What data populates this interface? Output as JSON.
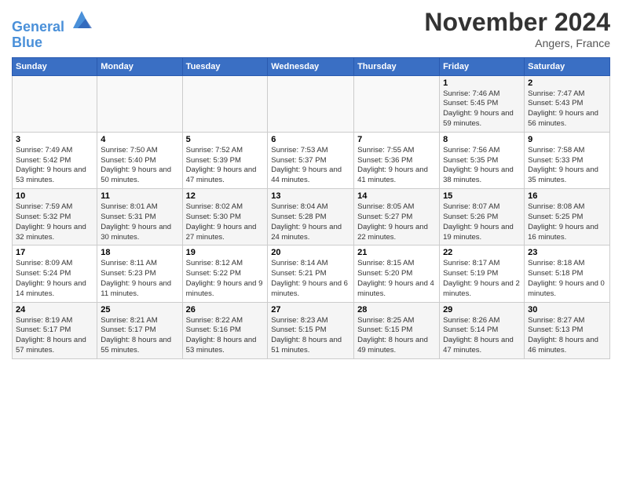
{
  "header": {
    "logo_line1": "General",
    "logo_line2": "Blue",
    "month": "November 2024",
    "location": "Angers, France"
  },
  "days_of_week": [
    "Sunday",
    "Monday",
    "Tuesday",
    "Wednesday",
    "Thursday",
    "Friday",
    "Saturday"
  ],
  "weeks": [
    [
      {
        "day": "",
        "info": ""
      },
      {
        "day": "",
        "info": ""
      },
      {
        "day": "",
        "info": ""
      },
      {
        "day": "",
        "info": ""
      },
      {
        "day": "",
        "info": ""
      },
      {
        "day": "1",
        "info": "Sunrise: 7:46 AM\nSunset: 5:45 PM\nDaylight: 9 hours and 59 minutes."
      },
      {
        "day": "2",
        "info": "Sunrise: 7:47 AM\nSunset: 5:43 PM\nDaylight: 9 hours and 56 minutes."
      }
    ],
    [
      {
        "day": "3",
        "info": "Sunrise: 7:49 AM\nSunset: 5:42 PM\nDaylight: 9 hours and 53 minutes."
      },
      {
        "day": "4",
        "info": "Sunrise: 7:50 AM\nSunset: 5:40 PM\nDaylight: 9 hours and 50 minutes."
      },
      {
        "day": "5",
        "info": "Sunrise: 7:52 AM\nSunset: 5:39 PM\nDaylight: 9 hours and 47 minutes."
      },
      {
        "day": "6",
        "info": "Sunrise: 7:53 AM\nSunset: 5:37 PM\nDaylight: 9 hours and 44 minutes."
      },
      {
        "day": "7",
        "info": "Sunrise: 7:55 AM\nSunset: 5:36 PM\nDaylight: 9 hours and 41 minutes."
      },
      {
        "day": "8",
        "info": "Sunrise: 7:56 AM\nSunset: 5:35 PM\nDaylight: 9 hours and 38 minutes."
      },
      {
        "day": "9",
        "info": "Sunrise: 7:58 AM\nSunset: 5:33 PM\nDaylight: 9 hours and 35 minutes."
      }
    ],
    [
      {
        "day": "10",
        "info": "Sunrise: 7:59 AM\nSunset: 5:32 PM\nDaylight: 9 hours and 32 minutes."
      },
      {
        "day": "11",
        "info": "Sunrise: 8:01 AM\nSunset: 5:31 PM\nDaylight: 9 hours and 30 minutes."
      },
      {
        "day": "12",
        "info": "Sunrise: 8:02 AM\nSunset: 5:30 PM\nDaylight: 9 hours and 27 minutes."
      },
      {
        "day": "13",
        "info": "Sunrise: 8:04 AM\nSunset: 5:28 PM\nDaylight: 9 hours and 24 minutes."
      },
      {
        "day": "14",
        "info": "Sunrise: 8:05 AM\nSunset: 5:27 PM\nDaylight: 9 hours and 22 minutes."
      },
      {
        "day": "15",
        "info": "Sunrise: 8:07 AM\nSunset: 5:26 PM\nDaylight: 9 hours and 19 minutes."
      },
      {
        "day": "16",
        "info": "Sunrise: 8:08 AM\nSunset: 5:25 PM\nDaylight: 9 hours and 16 minutes."
      }
    ],
    [
      {
        "day": "17",
        "info": "Sunrise: 8:09 AM\nSunset: 5:24 PM\nDaylight: 9 hours and 14 minutes."
      },
      {
        "day": "18",
        "info": "Sunrise: 8:11 AM\nSunset: 5:23 PM\nDaylight: 9 hours and 11 minutes."
      },
      {
        "day": "19",
        "info": "Sunrise: 8:12 AM\nSunset: 5:22 PM\nDaylight: 9 hours and 9 minutes."
      },
      {
        "day": "20",
        "info": "Sunrise: 8:14 AM\nSunset: 5:21 PM\nDaylight: 9 hours and 6 minutes."
      },
      {
        "day": "21",
        "info": "Sunrise: 8:15 AM\nSunset: 5:20 PM\nDaylight: 9 hours and 4 minutes."
      },
      {
        "day": "22",
        "info": "Sunrise: 8:17 AM\nSunset: 5:19 PM\nDaylight: 9 hours and 2 minutes."
      },
      {
        "day": "23",
        "info": "Sunrise: 8:18 AM\nSunset: 5:18 PM\nDaylight: 9 hours and 0 minutes."
      }
    ],
    [
      {
        "day": "24",
        "info": "Sunrise: 8:19 AM\nSunset: 5:17 PM\nDaylight: 8 hours and 57 minutes."
      },
      {
        "day": "25",
        "info": "Sunrise: 8:21 AM\nSunset: 5:17 PM\nDaylight: 8 hours and 55 minutes."
      },
      {
        "day": "26",
        "info": "Sunrise: 8:22 AM\nSunset: 5:16 PM\nDaylight: 8 hours and 53 minutes."
      },
      {
        "day": "27",
        "info": "Sunrise: 8:23 AM\nSunset: 5:15 PM\nDaylight: 8 hours and 51 minutes."
      },
      {
        "day": "28",
        "info": "Sunrise: 8:25 AM\nSunset: 5:15 PM\nDaylight: 8 hours and 49 minutes."
      },
      {
        "day": "29",
        "info": "Sunrise: 8:26 AM\nSunset: 5:14 PM\nDaylight: 8 hours and 47 minutes."
      },
      {
        "day": "30",
        "info": "Sunrise: 8:27 AM\nSunset: 5:13 PM\nDaylight: 8 hours and 46 minutes."
      }
    ]
  ]
}
